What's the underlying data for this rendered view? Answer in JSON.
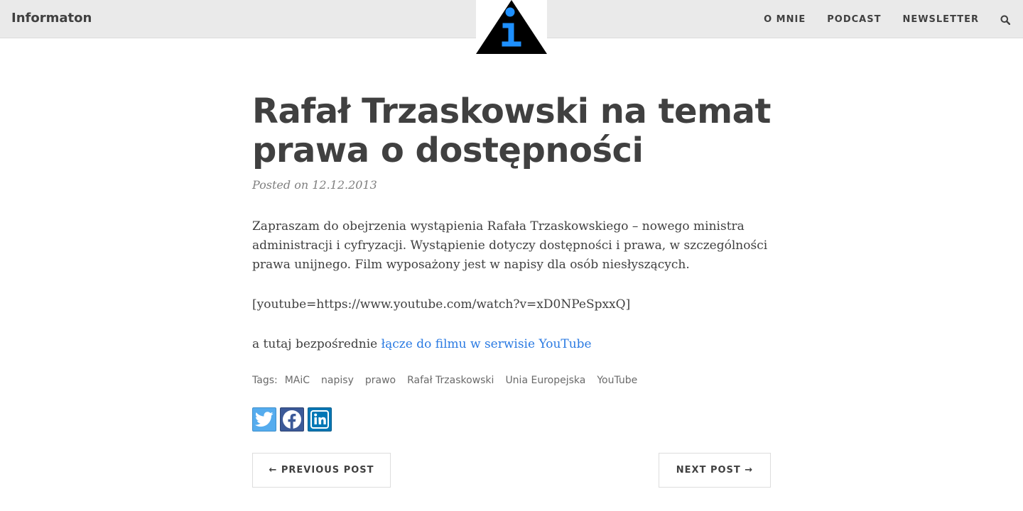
{
  "navbar": {
    "brand": "Informaton",
    "links": [
      "O MNIE",
      "PODCAST",
      "NEWSLETTER"
    ],
    "search_icon": "search-icon"
  },
  "logo": {
    "icon": "info-triangle-logo",
    "colors": {
      "triangle": "#000000",
      "glyph": "#1e90ff"
    }
  },
  "post": {
    "title": "Rafał Trzaskowski na temat prawa o dostępności",
    "meta": "Posted on 12.12.2013",
    "paragraphs": [
      "Zapraszam do obejrzenia wystąpienia Rafała Trzaskowskiego – nowego ministra administracji i cyfryzacji. Wystąpienie dotyczy dostępności i prawa, w szczególności prawa unijnego. Film wyposażony jest w napisy dla osób niesłyszących.",
      "[youtube=https://www.youtube.com/watch?v=xD0NPeSpxxQ]"
    ],
    "link_intro": "a tutaj bezpośrednie ",
    "link_text": "łącze do filmu w serwisie YouTube"
  },
  "tags": {
    "label": "Tags:",
    "items": [
      "MAiC",
      "napisy",
      "prawo",
      "Rafał Trzaskowski",
      "Unia Europejska",
      "YouTube"
    ]
  },
  "share": {
    "buttons": [
      "twitter-icon",
      "facebook-icon",
      "linkedin-icon"
    ],
    "colors": {
      "twitter": "#55acee",
      "facebook": "#3b5998",
      "linkedin": "#0077b5"
    }
  },
  "pager": {
    "previous": "← PREVIOUS POST",
    "next": "NEXT POST →"
  },
  "colors": {
    "text": "#404040",
    "link": "#2a7ae2",
    "navbar_bg": "#eaeaea"
  }
}
